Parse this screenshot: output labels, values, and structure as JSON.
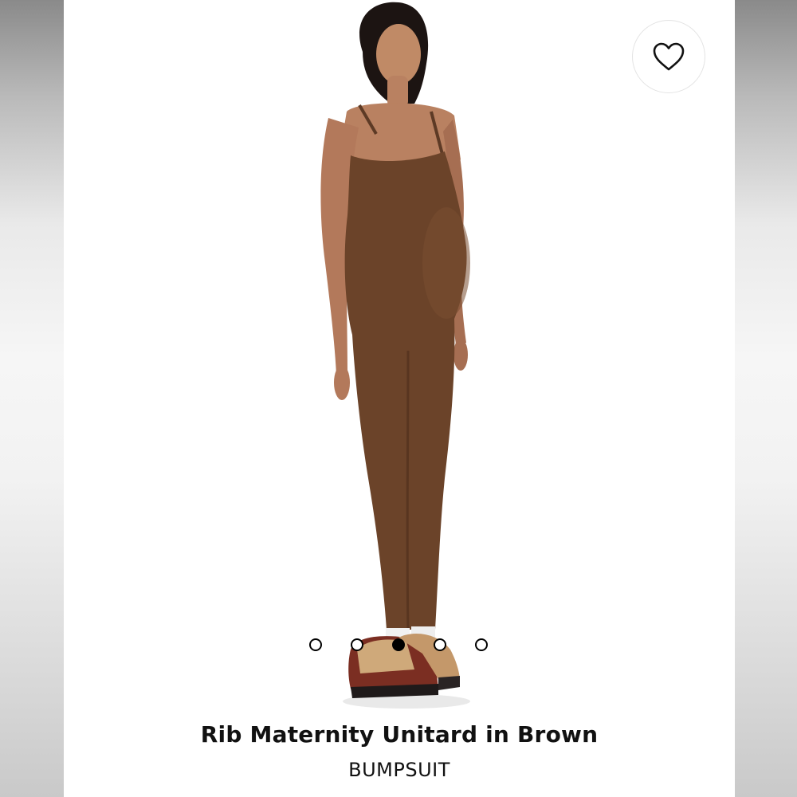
{
  "product": {
    "title": "Rib Maternity Unitard in Brown",
    "brand": "BUMPSUIT",
    "garment_color": "#6b4329"
  },
  "wishlist": {
    "icon": "heart-outline-icon",
    "favorited": false
  },
  "carousel": {
    "total_slides": 5,
    "active_index": 2
  }
}
